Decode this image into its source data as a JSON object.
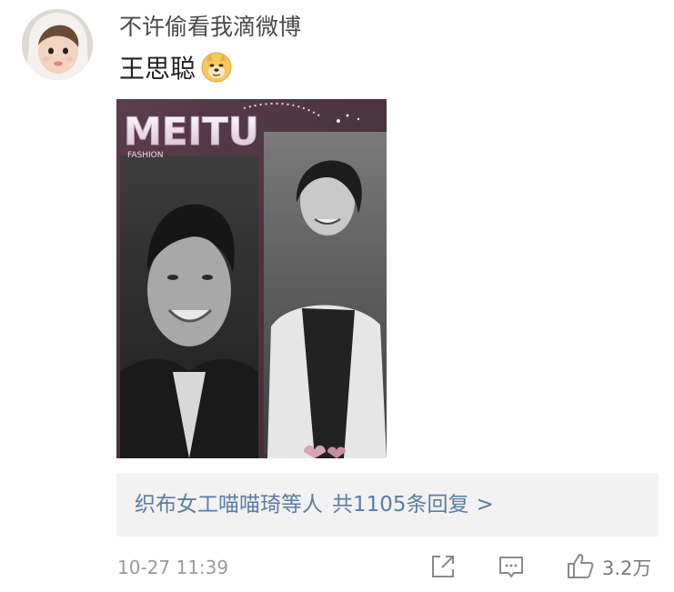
{
  "comment": {
    "username": "不许偷看我滴微博",
    "text": "王思聪",
    "emoji_icon": "doge-emoji-icon",
    "photo": {
      "logo_text": "MEITU",
      "logo_subtext": "FASHION"
    }
  },
  "replies": {
    "names": "织布女工喵喵琦等人",
    "count_text": "共1105条回复",
    "arrow": ">"
  },
  "footer": {
    "timestamp": "10-27 11:39",
    "share_icon": "share-icon",
    "comment_icon": "comment-icon",
    "like_icon": "thumbs-up-icon",
    "like_count": "3.2万"
  },
  "colors": {
    "link": "#5b7ca6",
    "muted": "#9a9a9a",
    "reply_bg": "#f2f2f2"
  }
}
